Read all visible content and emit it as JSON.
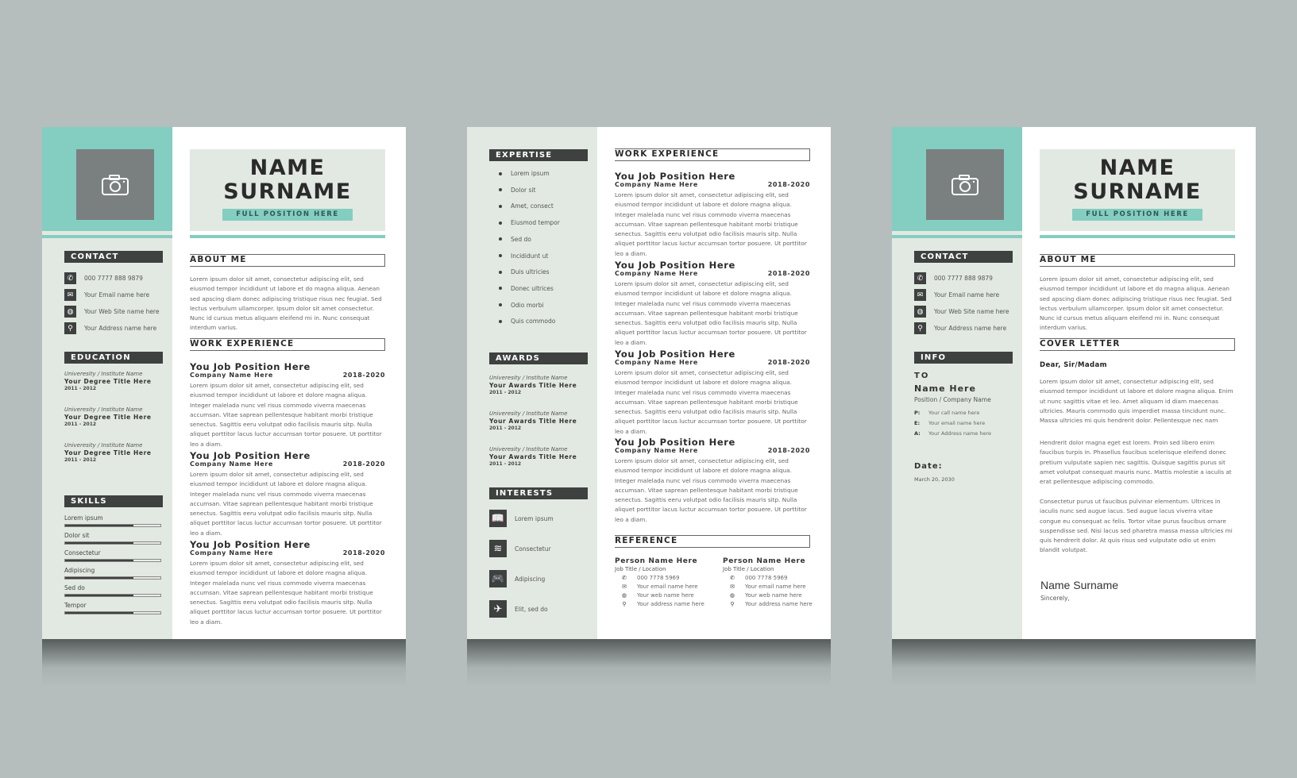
{
  "colors": {
    "accent": "#84cdc1",
    "dark": "#3e4140",
    "sidebar_bg": "#e2e9e2",
    "background": "#b5bebd"
  },
  "header": {
    "name_line1": "NAME",
    "name_line2": "SURNAME",
    "position": "FULL POSITION HERE",
    "photo_icon": "camera-icon"
  },
  "contact": {
    "title": "CONTACT",
    "items": [
      {
        "icon": "phone-icon",
        "glyph": "✆",
        "text": "000 7777 888 9879"
      },
      {
        "icon": "email-icon",
        "glyph": "✉",
        "text": "Your Email name here"
      },
      {
        "icon": "globe-icon",
        "glyph": "◍",
        "text": "Your Web Site name here"
      },
      {
        "icon": "location-icon",
        "glyph": "⚲",
        "text": "Your Address name here"
      }
    ]
  },
  "education": {
    "title": "EDUCATION",
    "items": [
      {
        "institute": "Univeresity / Institute Name",
        "degree": "Your Degree Title Here",
        "years": "2011 - 2012"
      },
      {
        "institute": "Univeresity / Institute Name",
        "degree": "Your Degree Title Here",
        "years": "2011 - 2012"
      },
      {
        "institute": "Univeresity / Institute Name",
        "degree": "Your Degree Title Here",
        "years": "2011 - 2012"
      }
    ]
  },
  "skills": {
    "title": "SKILLS",
    "items": [
      {
        "label": "Lorem ipsum",
        "level": 0.72
      },
      {
        "label": "Dolor sit",
        "level": 0.72
      },
      {
        "label": "Consectetur",
        "level": 0.72
      },
      {
        "label": "Adipiscing",
        "level": 0.72
      },
      {
        "label": "Sed do",
        "level": 0.72
      },
      {
        "label": "Tempor",
        "level": 0.72
      }
    ]
  },
  "about": {
    "title": "ABOUT ME",
    "text": "Lorem ipsum dolor sit amet, consectetur adipiscing elit, sed eiusmod tempor incididunt ut labore et do magna aliqua. Aenean sed apscing diam donec adipiscing tristique risus nec feugiat. Sed lectus verbulum ullamcorper. Ipsum dolor sit amet consectetur. Nunc id cursus metus aliquam eleifend mi in. Nunc consequat interdum varius."
  },
  "work": {
    "title": "WORK EXPERIENCE",
    "jobs": [
      {
        "title": "You Job Position Here",
        "company": "Company Name Here",
        "years": "2018-2020",
        "desc": "Lorem ipsum dolor sit amet, consectetur adipiscing elit, sed eiusmod tempor incididunt ut labore et dolore magna aliqua. Integer malelada nunc vel risus commodo viverra maecenas accumsan. Vitae saprean pellentesque habitant morbi tristique senectus. Sagittis eeru volutpat odio facilisis mauris sitp. Nulla aliquet porttitor lacus luctur accumsan tortor posuere. Ut porttitor leo a diam."
      },
      {
        "title": "You Job Position Here",
        "company": "Company Name Here",
        "years": "2018-2020",
        "desc": "Lorem ipsum dolor sit amet, consectetur adipiscing elit, sed eiusmod tempor incididunt ut labore et dolore magna aliqua. Integer malelada nunc vel risus commodo viverra maecenas accumsan. Vitae saprean pellentesque habitant morbi tristique senectus. Sagittis eeru volutpat odio facilisis mauris sitp. Nulla aliquet porttitor lacus luctur accumsan tortor posuere. Ut porttitor leo a diam."
      },
      {
        "title": "You Job Position Here",
        "company": "Company Name Here",
        "years": "2018-2020",
        "desc": "Lorem ipsum dolor sit amet, consectetur adipiscing elit, sed eiusmod tempor incididunt ut labore et dolore magna aliqua. Integer malelada nunc vel risus commodo viverra maecenas accumsan. Vitae saprean pellentesque habitant morbi tristique senectus. Sagittis eeru volutpat odio facilisis mauris sitp. Nulla aliquet porttitor lacus luctur accumsan tortor posuere. Ut porttitor leo a diam."
      },
      {
        "title": "You Job Position Here",
        "company": "Company Name Here",
        "years": "2018-2020",
        "desc": "Lorem ipsum dolor sit amet, consectetur adipiscing elit, sed eiusmod tempor incididunt ut labore et dolore magna aliqua. Integer malelada nunc vel risus commodo viverra maecenas accumsan. Vitae saprean pellentesque habitant morbi tristique senectus. Sagittis eeru volutpat odio facilisis mauris sitp. Nulla aliquet porttitor lacus luctur accumsan tortor posuere. Ut porttitor leo a diam."
      }
    ]
  },
  "expertise": {
    "title": "EXPERTISE",
    "items": [
      "Lorem ipsum",
      "Dolor sit",
      "Amet, consect",
      "Eiusmod tempor",
      "Sed do",
      "Incididunt ut",
      "Duis ultricies",
      "Donec ultrices",
      "Odio morbi",
      "Quis commodo"
    ]
  },
  "awards": {
    "title": "AWARDS",
    "items": [
      {
        "institute": "Univeresity / Institute Name",
        "title": "Your Awards Title Here",
        "years": "2011 - 2012"
      },
      {
        "institute": "Univeresity / Institute Name",
        "title": "Your Awards Title Here",
        "years": "2011 - 2012"
      },
      {
        "institute": "Univeresity / Institute Name",
        "title": "Your Awards Title Here",
        "years": "2011 - 2012"
      }
    ]
  },
  "interests": {
    "title": "INTERESTS",
    "items": [
      {
        "icon": "book-icon",
        "glyph": "📖",
        "label": "Lorem ipsum"
      },
      {
        "icon": "swimming-icon",
        "glyph": "≋",
        "label": "Consectetur"
      },
      {
        "icon": "gamepad-icon",
        "glyph": "🎮",
        "label": "Adipiscing"
      },
      {
        "icon": "airplane-icon",
        "glyph": "✈",
        "label": "Elit, sed do"
      }
    ]
  },
  "reference": {
    "title": "REFERENCE",
    "people": [
      {
        "name": "Person Name Here",
        "job": "Job Title / Location",
        "phone": "000 7778 5969",
        "email": "Your email name here",
        "web": "Your web name here",
        "address": "Your address name here"
      },
      {
        "name": "Person Name Here",
        "job": "Job Title / Location",
        "phone": "000 7778 5969",
        "email": "Your email name here",
        "web": "Your web name here",
        "address": "Your address name here"
      }
    ]
  },
  "info": {
    "title": "INFO",
    "to_label": "TO",
    "name": "Name Here",
    "position": "Position / Company Name",
    "rows": [
      {
        "key": "P:",
        "value": "Your  call name here"
      },
      {
        "key": "E:",
        "value": "Your  email name here"
      },
      {
        "key": "A:",
        "value": "Your  Address name here"
      }
    ],
    "date_label": "Date:",
    "date_value": "March 20, 2030"
  },
  "cover_letter": {
    "title": "COVER LETTER",
    "greeting": "Dear, Sir/Madam",
    "paragraphs": [
      "Lorem ipsum dolor sit amet, consectetur adipiscing elit, sed eiusmod tempor incididunt ut labore et dolore magna aliqua. Enim ut nunc sagittis vitae et leo. Amet aliquam id diam maecenas ultricies. Mauris commodo quis imperdiet massa tincidunt nunc. Massa ultricies mi quis hendrerit dolor. Pellentesque nec nam",
      "Hendrerit dolor magna eget est lorem. Proin sed libero enim faucibus turpis in. Phasellus faucibus scelerisque eleifend donec pretium vulputate sapien nec sagittis. Quisque sagittis purus sit amet volutpat consequat mauris nunc. Mattis molestie a iaculis at erat pellentesque adipiscing commodo.",
      "Consectetur purus ut faucibus pulvinar elementum. Ultrices in iaculis nunc sed augue lacus. Sed augue lacus viverra vitae congue eu consequat ac felis. Tortor vitae purus faucibus ornare suspendisse sed. Nisi lacus sed pharetra massa massa ultricies mi quis hendrerit dolor. At quis risus sed vulputate odio ut enim blandit volutpat."
    ],
    "signature_name": "Name Surname",
    "sign_off": "Sincerely,"
  }
}
